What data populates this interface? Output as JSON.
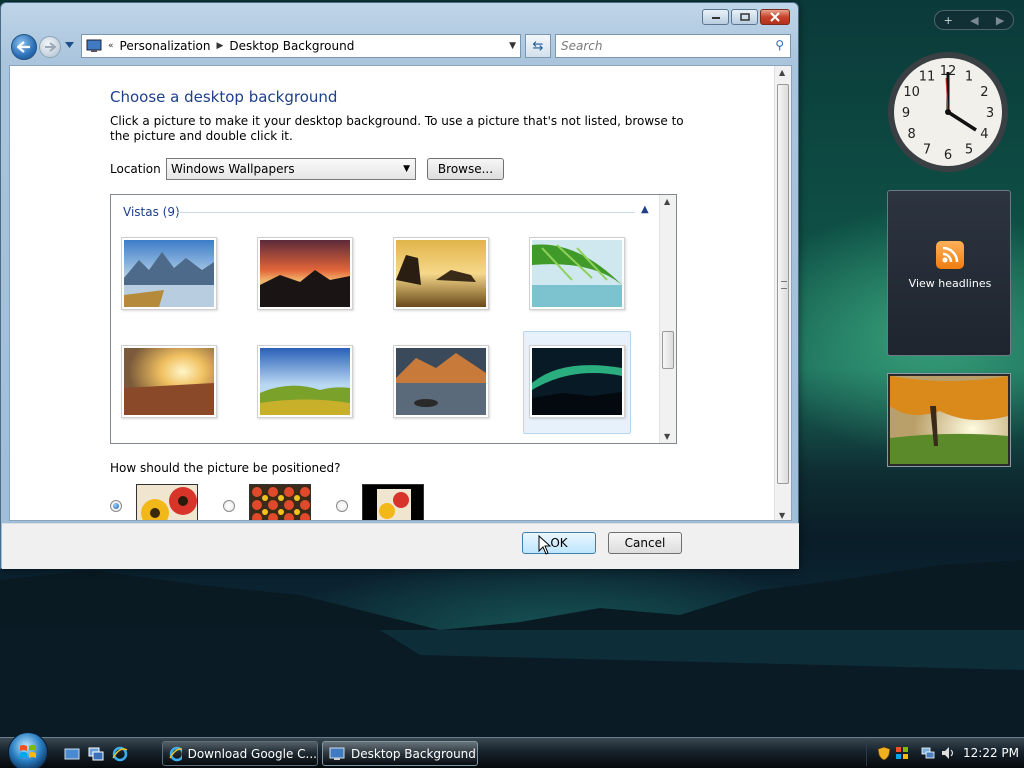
{
  "window": {
    "title": "Desktop Background",
    "breadcrumb": [
      "Personalization",
      "Desktop Background"
    ],
    "search_placeholder": "Search",
    "heading": "Choose a desktop background",
    "description": "Click a picture to make it your desktop background. To use a picture that's not listed, browse to the picture and double click it.",
    "location_label": "Location",
    "location_value": "Windows Wallpapers",
    "browse_label": "Browse...",
    "group_label": "Vistas (9)",
    "position_label": "How should the picture be positioned?",
    "position_options": [
      "fit-to-screen",
      "tile",
      "center"
    ],
    "position_selected": 0,
    "ok_label": "OK",
    "cancel_label": "Cancel",
    "selected_thumbnail": 7
  },
  "sidebar": {
    "feed_label": "View headlines",
    "clock_numbers": [
      "12",
      "1",
      "2",
      "3",
      "4",
      "5",
      "6",
      "7",
      "8",
      "9",
      "10",
      "11"
    ]
  },
  "taskbar": {
    "buttons": [
      {
        "label": "Download Google C...",
        "active": false
      },
      {
        "label": "Desktop Background",
        "active": true
      }
    ],
    "time": "12:22 PM"
  },
  "colors": {
    "heading": "#1e3f8a",
    "accent": "#3c7fb1"
  }
}
